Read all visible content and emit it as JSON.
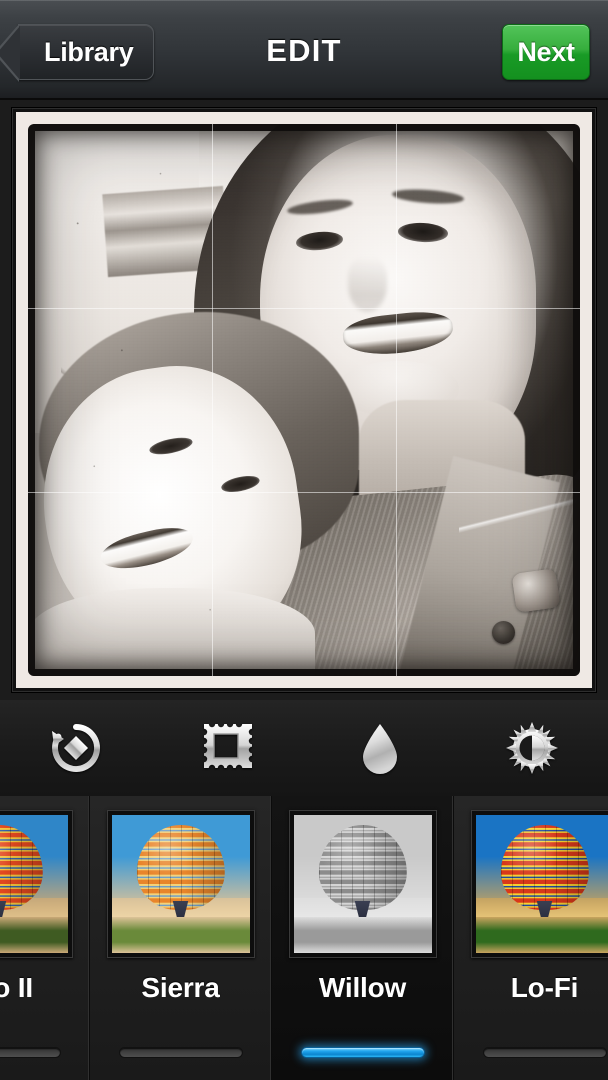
{
  "navbar": {
    "back_label": "Library",
    "title": "EDIT",
    "next_label": "Next",
    "next_color": "#2aa633"
  },
  "photo": {
    "description": "Black and white selfie of a smiling woman with a young smiling child, cream paper border with dark vignette",
    "filter_applied": "Willow",
    "grid_overlay": "rule-of-thirds",
    "border_color": "#efe9e4"
  },
  "toolbar": {
    "items": [
      {
        "name": "rotate-icon",
        "label": "Rotate"
      },
      {
        "name": "frame-icon",
        "label": "Frame"
      },
      {
        "name": "blur-icon",
        "label": "Blur"
      },
      {
        "name": "lux-icon",
        "label": "Lux"
      }
    ]
  },
  "filters": {
    "selected": "Willow",
    "selected_bar_color": "#1fa3ec",
    "items": [
      {
        "label": "Pro II",
        "selected": false,
        "partial": true,
        "style": {
          "sky_top": "#2f86c8",
          "sky_bottom": "#e0c28c",
          "balloon_a": "#e2481f",
          "balloon_b": "#f2c33c",
          "balloon_c": "#2f5fa8",
          "ground": "#3f5b22",
          "haze": "#caa977"
        }
      },
      {
        "label": "Sierra",
        "selected": false,
        "partial": false,
        "style": {
          "sky_top": "#3f9ad6",
          "sky_bottom": "#eed6a8",
          "balloon_a": "#e8852b",
          "balloon_b": "#f3d27a",
          "balloon_c": "#6f9ec8",
          "ground": "#6a8a3a",
          "haze": "#ddc398"
        }
      },
      {
        "label": "Willow",
        "selected": true,
        "partial": false,
        "style": {
          "sky_top": "#c9c9c9",
          "sky_bottom": "#e8e8e8",
          "balloon_a": "#8c8c8c",
          "balloon_b": "#d5d5d5",
          "balloon_c": "#a8a8a8",
          "ground": "#9a9a9a",
          "haze": "#dedede"
        }
      },
      {
        "label": "Lo-Fi",
        "selected": false,
        "partial": false,
        "style": {
          "sky_top": "#1a74c4",
          "sky_bottom": "#e8c77a",
          "balloon_a": "#d8381a",
          "balloon_b": "#f6d033",
          "balloon_c": "#1f49a0",
          "ground": "#2f6a1e",
          "haze": "#c9a45f"
        }
      }
    ]
  }
}
